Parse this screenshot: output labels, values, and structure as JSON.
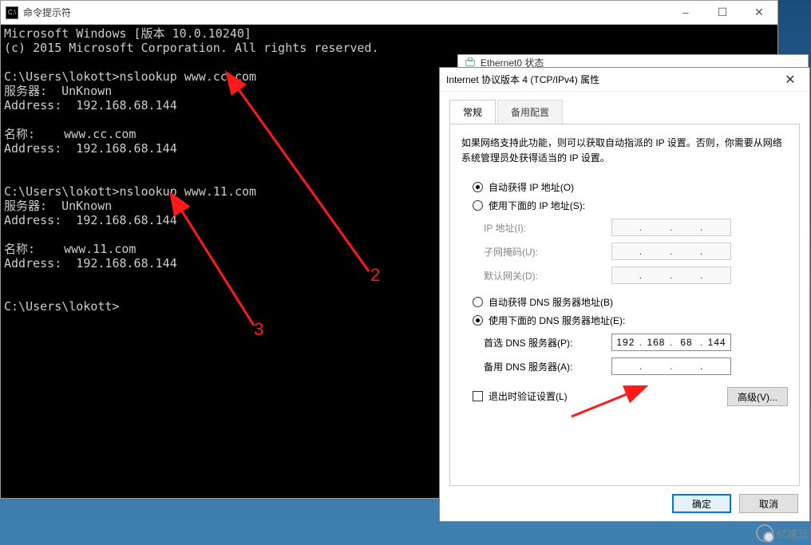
{
  "desktop": {
    "watermark": "亿速云"
  },
  "cmd": {
    "title": "命令提示符",
    "line1": "Microsoft Windows [版本 10.0.10240]",
    "line2": "(c) 2015 Microsoft Corporation. All rights reserved.",
    "query1": {
      "prompt": "C:\\Users\\lokott>nslookup www.cc.com",
      "server_label": "服务器:  UnKnown",
      "address1": "Address:  192.168.68.144",
      "name": "名称:    www.cc.com",
      "address2": "Address:  192.168.68.144"
    },
    "query2": {
      "prompt": "C:\\Users\\lokott>nslookup www.11.com",
      "server_label": "服务器:  UnKnown",
      "address1": "Address:  192.168.68.144",
      "name": "名称:    www.11.com",
      "address2": "Address:  192.168.68.144"
    },
    "prompt_idle": "C:\\Users\\lokott>"
  },
  "ethernet": {
    "title": "Ethernet0 状态"
  },
  "ipv4": {
    "title": "Internet 协议版本 4 (TCP/IPv4) 属性",
    "tabs": {
      "general": "常规",
      "alt": "备用配置"
    },
    "description": "如果网络支持此功能，则可以获取自动指派的 IP 设置。否则，你需要从网络系统管理员处获得适当的 IP 设置。",
    "radio_auto_ip": "自动获得 IP 地址(O)",
    "radio_manual_ip": "使用下面的 IP 地址(S):",
    "ip_label": "IP 地址(I):",
    "mask_label": "子网掩码(U):",
    "gateway_label": "默认网关(D):",
    "radio_auto_dns": "自动获得 DNS 服务器地址(B)",
    "radio_manual_dns": "使用下面的 DNS 服务器地址(E):",
    "preferred_dns_label": "首选 DNS 服务器(P):",
    "alt_dns_label": "备用 DNS 服务器(A):",
    "preferred_dns": {
      "a": "192",
      "b": "168",
      "c": "68",
      "d": "144"
    },
    "validate_label": "退出时验证设置(L)",
    "advanced": "高级(V)...",
    "ok": "确定",
    "cancel": "取消"
  },
  "annotations": {
    "label2": "2",
    "label3": "3"
  }
}
